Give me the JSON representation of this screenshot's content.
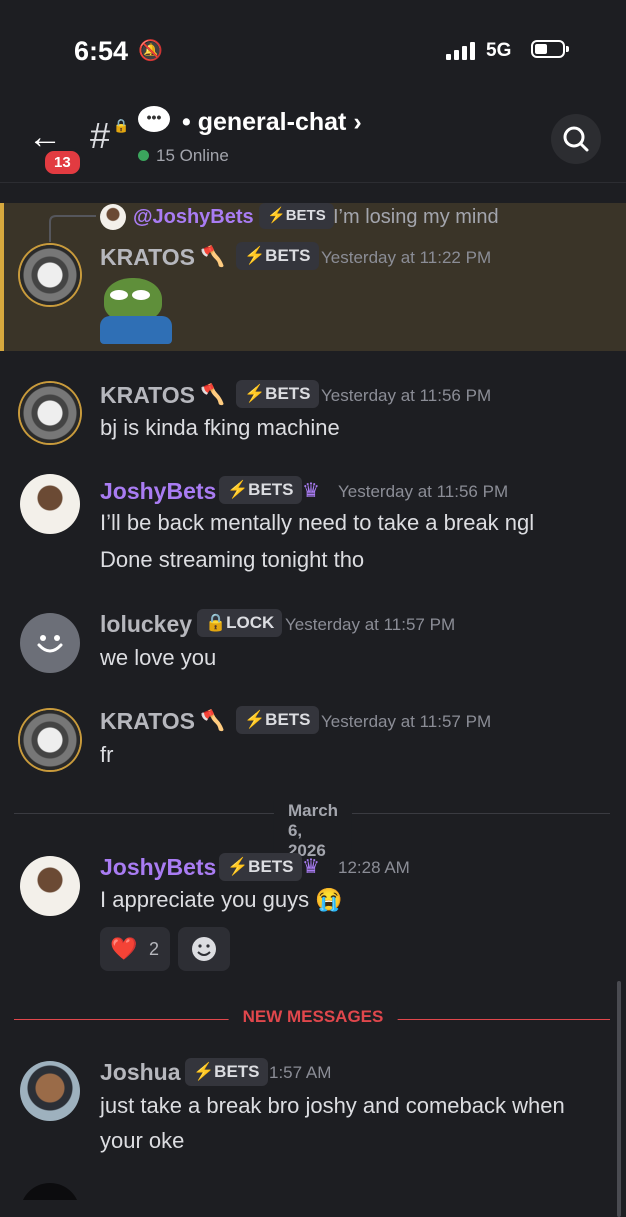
{
  "status": {
    "time": "6:54",
    "network": "5G"
  },
  "header": {
    "back_badge": "13",
    "channel_name": "general-chat",
    "online": "15 Online"
  },
  "reply": {
    "user": "@JoshyBets",
    "tag": "BETS",
    "text": "I’m losing my mind"
  },
  "messages": [
    {
      "name": "KRATOS",
      "tag": "BETS",
      "timestamp": "Yesterday at 11:22 PM",
      "lines": []
    },
    {
      "name": "KRATOS",
      "tag": "BETS",
      "timestamp": "Yesterday at 11:56 PM",
      "lines": [
        "bj is kinda fking machine"
      ]
    },
    {
      "name": "JoshyBets",
      "tag": "BETS",
      "timestamp": "Yesterday at 11:56 PM",
      "lines": [
        "I’ll be back mentally need to take a break ngl",
        "Done streaming tonight tho"
      ]
    },
    {
      "name": "loluckey",
      "tag": "LOCK",
      "timestamp": "Yesterday at 11:57 PM",
      "lines": [
        "we love you"
      ]
    },
    {
      "name": "KRATOS",
      "tag": "BETS",
      "timestamp": "Yesterday at 11:57 PM",
      "lines": [
        "fr"
      ]
    },
    {
      "name": "JoshyBets",
      "tag": "BETS",
      "timestamp": "12:28 AM",
      "lines": [
        "I appreciate you guys 😭"
      ]
    },
    {
      "name": "Joshua",
      "tag": "BETS",
      "timestamp": "1:57 AM",
      "lines": [
        "just take a break bro joshy and comeback when",
        "your oke"
      ]
    }
  ],
  "date_divider": "March 6, 2026",
  "reaction": {
    "emoji": "❤️",
    "count": "2"
  },
  "new_messages_label": "NEW MESSAGES",
  "colors": {
    "accent": "#a97cf3",
    "new_messages": "#e0474c",
    "online": "#3ba55d",
    "highlight": "#d6a83e"
  }
}
